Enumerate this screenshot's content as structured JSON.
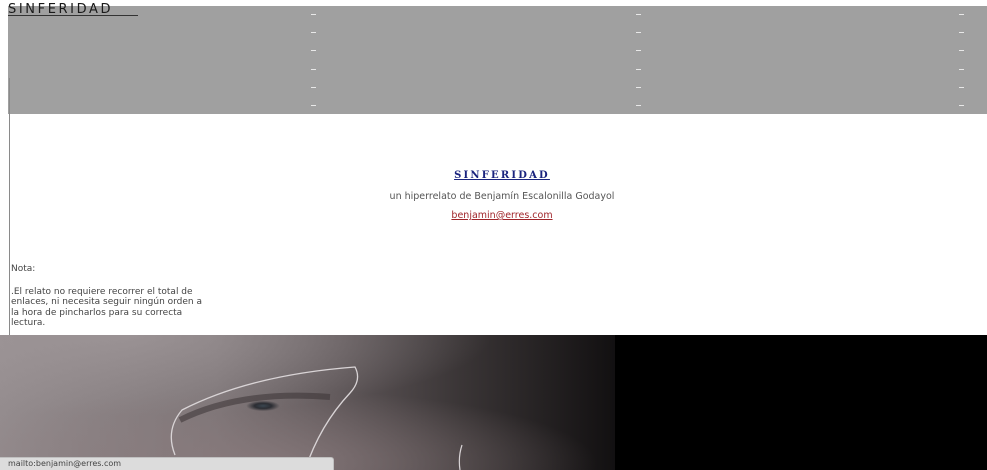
{
  "header": {
    "site_title": "SINFERIDAD",
    "band_color": "#a0a0a0"
  },
  "main": {
    "story_title": "SINFERIDAD",
    "subtitle": "un hiperrelato de Benjamín Escalonilla Godayol",
    "email": "benjamin@erres.com",
    "title_color": "#1a237e",
    "email_color": "#a0252a"
  },
  "note": {
    "label": "Nota:",
    "text": ".El relato no requiere recorrer el total de enlaces, ni necesita seguir ningún orden a la hora de pincharlos para su correcta lectura."
  },
  "status_bar": {
    "text": "mailto:benjamin@erres.com"
  }
}
